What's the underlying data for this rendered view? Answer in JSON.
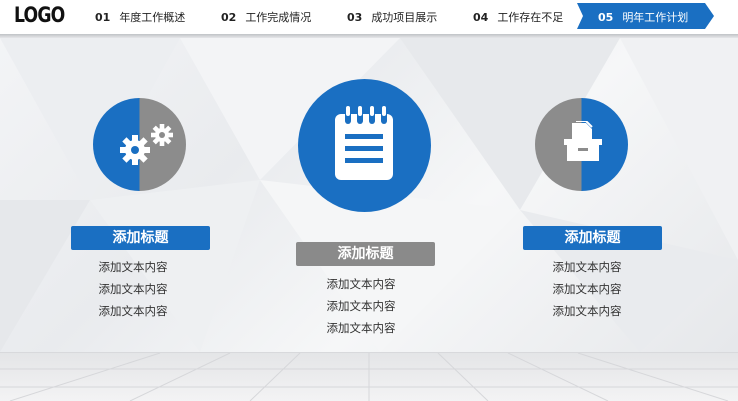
{
  "header": {
    "logo": "LOGO",
    "nav": [
      {
        "num": "01",
        "label": "年度工作概述"
      },
      {
        "num": "02",
        "label": "工作完成情况"
      },
      {
        "num": "03",
        "label": "成功项目展示"
      },
      {
        "num": "04",
        "label": "工作存在不足"
      },
      {
        "num": "05",
        "label": "明年工作计划"
      }
    ]
  },
  "colors": {
    "blue": "#1a6fc2",
    "gray": "#8c8c8c"
  },
  "columns": [
    {
      "title": "添加标题",
      "lines": [
        "添加文本内容",
        "添加文本内容",
        "添加文本内容"
      ],
      "icon": "gears-icon"
    },
    {
      "title": "添加标题",
      "lines": [
        "添加文本内容",
        "添加文本内容",
        "添加文本内容"
      ],
      "icon": "notepad-icon"
    },
    {
      "title": "添加标题",
      "lines": [
        "添加文本内容",
        "添加文本内容",
        "添加文本内容"
      ],
      "icon": "file-box-icon"
    }
  ]
}
